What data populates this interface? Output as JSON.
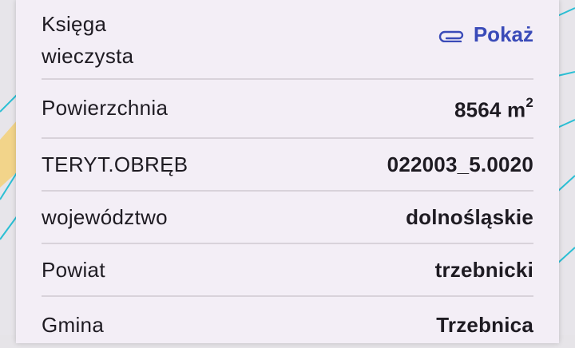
{
  "colors": {
    "accent": "#3a4bb8",
    "card_bg": "#f3eef6",
    "divider": "#d8d2da"
  },
  "land_registry": {
    "label_line1": "Księga",
    "label_line2": "wieczysta",
    "link_icon": "paperclip-icon",
    "link_label": "Pokaż"
  },
  "rows": [
    {
      "label": "Powierzchnia",
      "value": "8564 m",
      "unit_sup": "2"
    },
    {
      "label": "TERYT.OBRĘB",
      "value": "022003_5.0020"
    },
    {
      "label": "województwo",
      "value": "dolnośląskie"
    },
    {
      "label": "Powiat",
      "value": "trzebnicki"
    },
    {
      "label": "Gmina",
      "value": "Trzebnica"
    }
  ]
}
